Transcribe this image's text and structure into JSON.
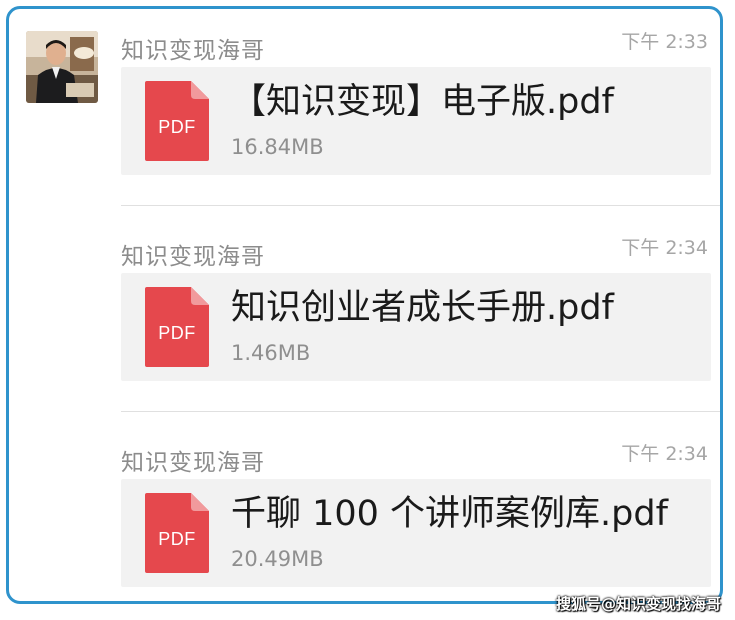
{
  "messages": [
    {
      "sender": "知识变现海哥",
      "time": "下午 2:33",
      "file": {
        "icon": "pdf-file-icon",
        "icon_label": "PDF",
        "name": "【知识变现】电子版.pdf",
        "size": "16.84MB"
      }
    },
    {
      "sender": "知识变现海哥",
      "time": "下午 2:34",
      "file": {
        "icon": "pdf-file-icon",
        "icon_label": "PDF",
        "name": "知识创业者成长手册.pdf",
        "size": "1.46MB"
      }
    },
    {
      "sender": "知识变现海哥",
      "time": "下午 2:34",
      "file": {
        "icon": "pdf-file-icon",
        "icon_label": "PDF",
        "name": "千聊 100 个讲师案例库.pdf",
        "size": "20.49MB"
      }
    }
  ],
  "watermark": "搜狐号@知识变现找海哥",
  "colors": {
    "frame_border": "#2f93cc",
    "pdf_red": "#e5484d",
    "pdf_fold": "#f19a9c",
    "card_bg": "#f2f2f2"
  }
}
